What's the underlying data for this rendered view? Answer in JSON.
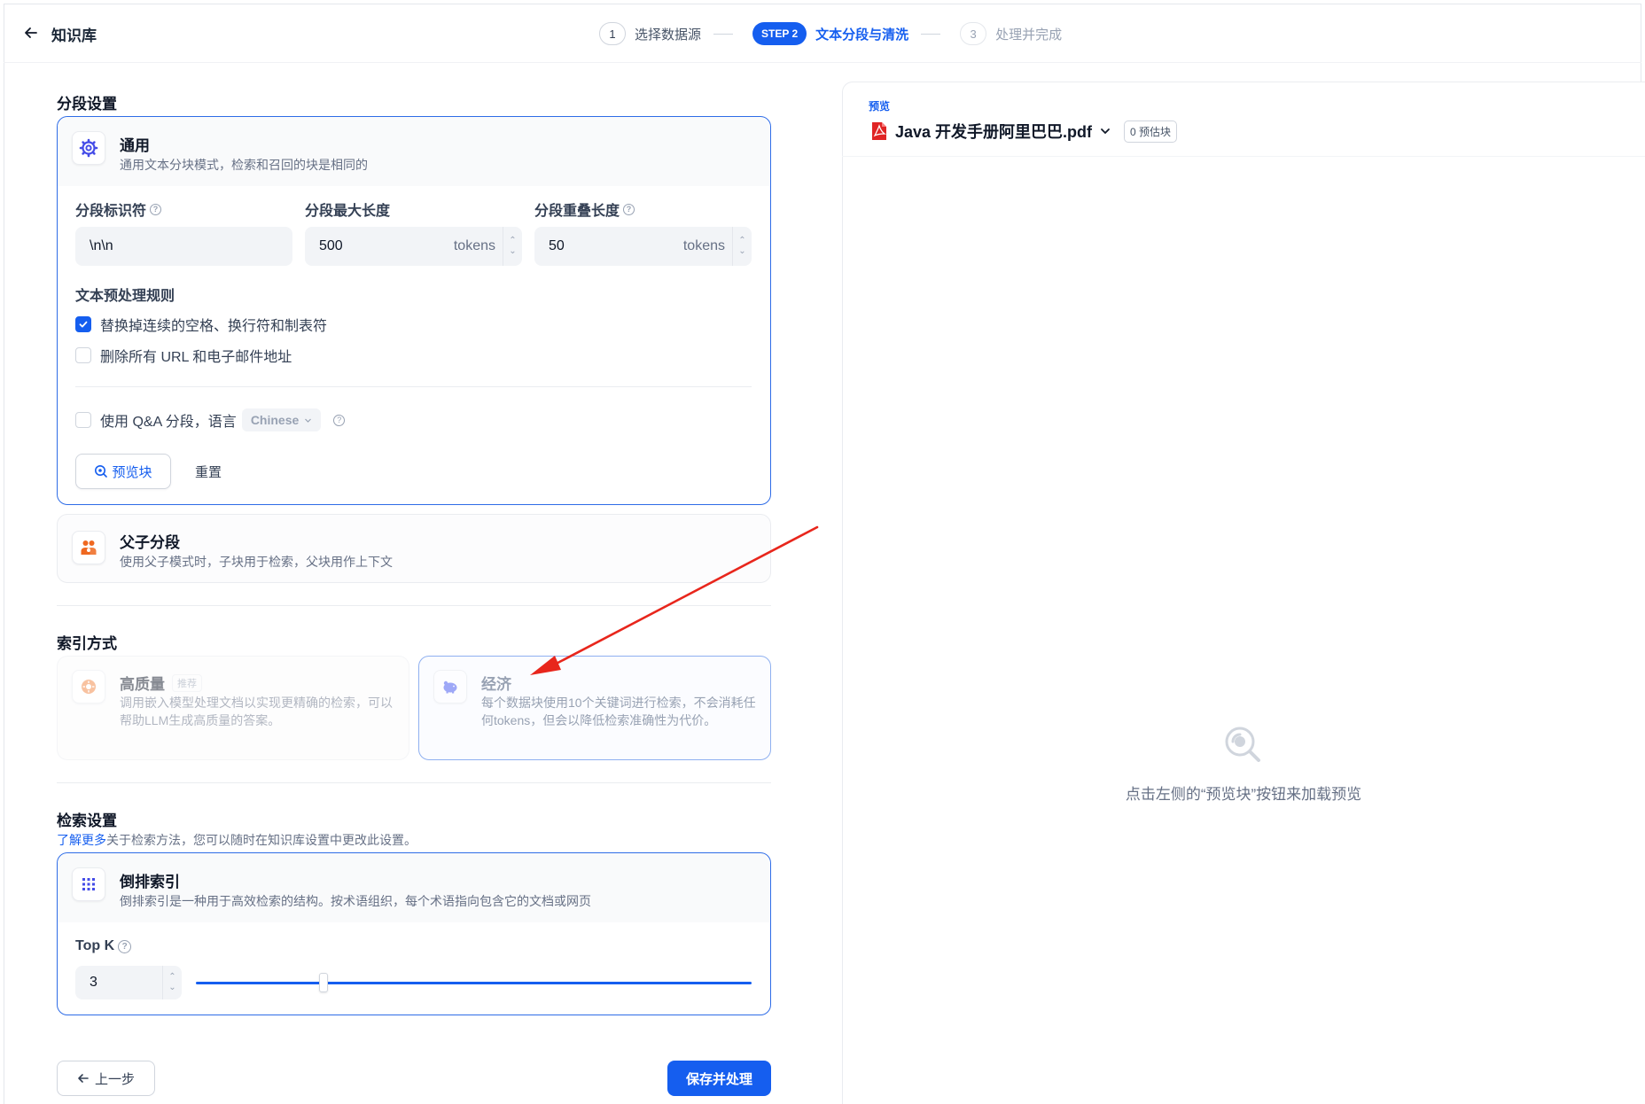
{
  "header": {
    "title": "知识库",
    "steps": [
      {
        "num": "1",
        "label": "选择数据源"
      },
      {
        "badge": "STEP 2",
        "label": "文本分段与清洗"
      },
      {
        "num": "3",
        "label": "处理并完成"
      }
    ]
  },
  "segment": {
    "section_title": "分段设置",
    "general": {
      "title": "通用",
      "desc": "通用文本分块模式，检索和召回的块是相同的",
      "delimiter_label": "分段标识符",
      "delimiter_value": "\\n\\n",
      "max_len_label": "分段最大长度",
      "max_len_value": "500",
      "max_len_unit": "tokens",
      "overlap_label": "分段重叠长度",
      "overlap_value": "50",
      "overlap_unit": "tokens",
      "rules_title": "文本预处理规则",
      "rule1": "替换掉连续的空格、换行符和制表符",
      "rule1_checked": true,
      "rule2": "删除所有 URL 和电子邮件地址",
      "rule2_checked": false,
      "qa_label": "使用 Q&A 分段，语言",
      "qa_lang": "Chinese",
      "preview_btn": "预览块",
      "reset_btn": "重置"
    },
    "parent_child": {
      "title": "父子分段",
      "desc": "使用父子模式时，子块用于检索，父块用作上下文"
    }
  },
  "index": {
    "section_title": "索引方式",
    "high_quality": {
      "title": "高质量",
      "tag": "推荐",
      "desc": "调用嵌入模型处理文档以实现更精确的检索，可以帮助LLM生成高质量的答案。"
    },
    "economy": {
      "title": "经济",
      "desc": "每个数据块使用10个关键词进行检索，不会消耗任何tokens，但会以降低检索准确性为代价。"
    }
  },
  "retrieval": {
    "section_title": "检索设置",
    "learn_more": "了解更多",
    "note": "关于检索方法，您可以随时在知识库设置中更改此设置。",
    "inverted": {
      "title": "倒排索引",
      "desc": "倒排索引是一种用于高效检索的结构。按术语组织，每个术语指向包含它的文档或网页"
    },
    "topk_label": "Top K",
    "topk_value": "3",
    "topk_fraction": 0.23
  },
  "footer": {
    "prev_btn": "上一步",
    "save_btn": "保存并处理"
  },
  "preview": {
    "label": "预览",
    "file_name": "Java 开发手册阿里巴巴.pdf",
    "estimate": "0 预估块",
    "empty_text": "点击左侧的“预览块”按钮来加载预览"
  },
  "colors": {
    "accent": "#155eef",
    "arrow": "#e8261c",
    "pdf": "#e02424"
  }
}
